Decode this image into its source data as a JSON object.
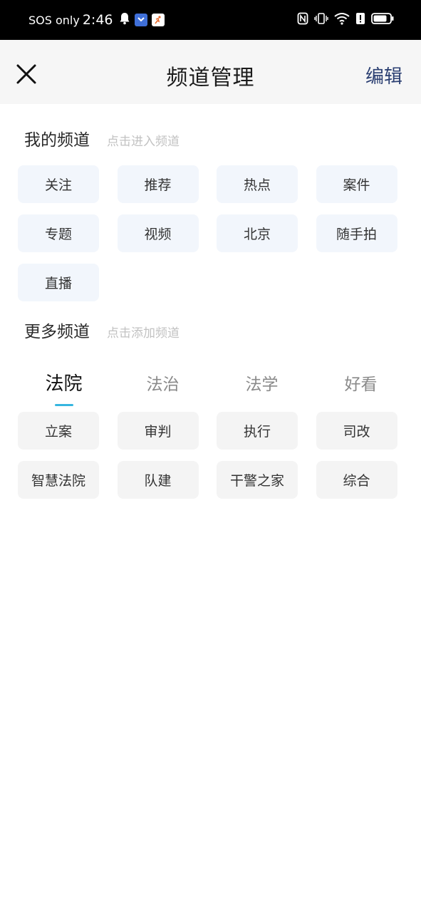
{
  "status_bar": {
    "carrier": "SOS only",
    "time": "2:46",
    "battery_level": 0.8
  },
  "header": {
    "title": "频道管理",
    "edit_label": "编辑"
  },
  "my_channels": {
    "title": "我的频道",
    "hint": "点击进入频道",
    "items": [
      "关注",
      "推荐",
      "热点",
      "案件",
      "专题",
      "视频",
      "北京",
      "随手拍",
      "直播"
    ]
  },
  "more_channels": {
    "title": "更多频道",
    "hint": "点击添加频道",
    "tabs": [
      "法院",
      "法治",
      "法学",
      "好看"
    ],
    "active_tab": "法院",
    "items": [
      "立案",
      "审判",
      "执行",
      "司改",
      "智慧法院",
      "队建",
      "干警之家",
      "综合"
    ]
  },
  "colors": {
    "accent": "#36b6e0",
    "edit": "#2b3f72",
    "my_chip_bg": "#f2f6fc",
    "more_chip_bg": "#f4f4f4"
  }
}
